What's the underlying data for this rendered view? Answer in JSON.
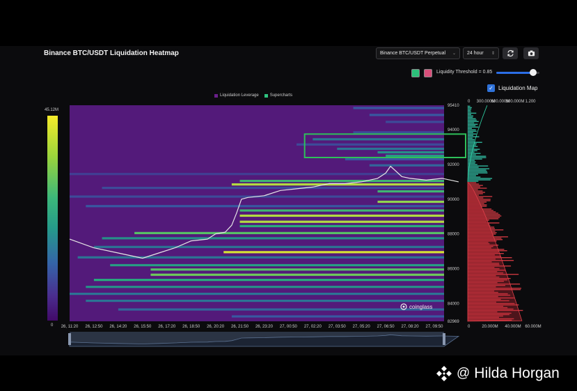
{
  "header": {
    "title": "Binance BTC/USDT Liquidation Heatmap",
    "pair_select": "Binance BTC/USDT Perpetual",
    "range_select": "24 hour",
    "refresh_icon": "refresh-icon",
    "camera_icon": "camera-icon"
  },
  "controls": {
    "threshold_label": "Liquidity Threshold = 0.85",
    "threshold_value": 0.85,
    "liquidation_map_label": "Liquidation Map",
    "liquidation_map_checked": true,
    "swatch_colors": [
      "#2cc07a",
      "#d94f7a"
    ]
  },
  "legend": {
    "items": [
      {
        "label": "Liquidation Leverage",
        "color": "#6a1f8a"
      },
      {
        "label": "Supercharts",
        "color": "#2ec27e"
      }
    ]
  },
  "colorbar": {
    "max_label": "45.12M",
    "min_label": "0"
  },
  "watermark": {
    "at": "@",
    "name": "Hilda Horgan",
    "icon": "diamond-logo-icon"
  },
  "brand": {
    "name": "coinglass",
    "icon": "coinglass-logo-icon"
  },
  "chart_data": {
    "type": "heatmap",
    "title": "Binance BTC/USDT Liquidation Heatmap",
    "x_tick_labels": [
      "26, 11:20",
      "26, 12:50",
      "26, 14:20",
      "26, 15:50",
      "26, 17:20",
      "26, 18:50",
      "26, 20:20",
      "26, 21:50",
      "26, 23:20",
      "27, 00:50",
      "27, 02:20",
      "27, 03:50",
      "27, 05:20",
      "27, 06:50",
      "27, 08:20",
      "27, 09:50"
    ],
    "y_tick_labels": [
      "95410",
      "94000",
      "92000",
      "90000",
      "88000",
      "86000",
      "84000",
      "82969"
    ],
    "ylim": [
      82969,
      95410
    ],
    "colorbar_range": [
      0,
      45.12
    ],
    "colorbar_unit": "M",
    "price_series": {
      "x_hours": [
        0,
        1.5,
        3,
        4.5,
        5.5,
        6.5,
        7.5,
        8.5,
        9,
        9.6,
        10,
        10.3,
        10.6,
        11,
        12,
        13,
        14,
        15,
        16,
        17,
        18,
        19,
        19.5,
        19.8,
        20.5,
        21,
        22,
        23,
        24
      ],
      "price": [
        87700,
        87200,
        86900,
        86600,
        86900,
        87200,
        87600,
        87700,
        88000,
        88100,
        88500,
        89200,
        90000,
        90100,
        90200,
        90500,
        90600,
        90700,
        90900,
        90900,
        91000,
        91200,
        91500,
        91900,
        91300,
        91200,
        91100,
        91200,
        91000
      ]
    },
    "liquidation_levels": [
      {
        "price": 95250,
        "start_hour": 17.5,
        "intensity": 0.35
      },
      {
        "price": 94850,
        "start_hour": 18.5,
        "intensity": 0.35
      },
      {
        "price": 94450,
        "start_hour": 19.5,
        "intensity": 0.3
      },
      {
        "price": 93850,
        "start_hour": 17.5,
        "intensity": 0.3
      },
      {
        "price": 93450,
        "start_hour": 15.0,
        "intensity": 0.45
      },
      {
        "price": 93150,
        "start_hour": 14.0,
        "intensity": 0.3
      },
      {
        "price": 92900,
        "start_hour": 16.5,
        "intensity": 0.45
      },
      {
        "price": 92700,
        "start_hour": 19.0,
        "intensity": 0.55
      },
      {
        "price": 92500,
        "start_hour": 19.5,
        "intensity": 0.6
      },
      {
        "price": 92300,
        "start_hour": 17.0,
        "intensity": 0.35
      },
      {
        "price": 91950,
        "start_hour": 18.5,
        "intensity": 0.4
      },
      {
        "price": 91450,
        "start_hour": 0.0,
        "intensity": 0.25
      },
      {
        "price": 91050,
        "start_hour": 10.5,
        "intensity": 0.7
      },
      {
        "price": 90850,
        "start_hour": 10.0,
        "intensity": 0.9
      },
      {
        "price": 90650,
        "start_hour": 2.0,
        "intensity": 0.3
      },
      {
        "price": 90450,
        "start_hour": 19.0,
        "intensity": 0.7
      },
      {
        "price": 90150,
        "start_hour": 0.0,
        "intensity": 0.3
      },
      {
        "price": 89850,
        "start_hour": 19.0,
        "intensity": 0.85
      },
      {
        "price": 89600,
        "start_hour": 1.0,
        "intensity": 0.35
      },
      {
        "price": 89350,
        "start_hour": 10.5,
        "intensity": 0.7
      },
      {
        "price": 89050,
        "start_hour": 10.5,
        "intensity": 0.9
      },
      {
        "price": 88700,
        "start_hour": 10.5,
        "intensity": 0.9
      },
      {
        "price": 88450,
        "start_hour": 10.5,
        "intensity": 0.65
      },
      {
        "price": 88050,
        "start_hour": 4.0,
        "intensity": 0.75
      },
      {
        "price": 87750,
        "start_hour": 2.0,
        "intensity": 0.55
      },
      {
        "price": 87250,
        "start_hour": 1.5,
        "intensity": 0.45
      },
      {
        "price": 86950,
        "start_hour": 9.5,
        "intensity": 0.95
      },
      {
        "price": 86650,
        "start_hour": 0.5,
        "intensity": 0.45
      },
      {
        "price": 86200,
        "start_hour": 2.5,
        "intensity": 0.6
      },
      {
        "price": 85950,
        "start_hour": 5.0,
        "intensity": 0.75
      },
      {
        "price": 85650,
        "start_hour": 5.0,
        "intensity": 0.8
      },
      {
        "price": 85350,
        "start_hour": 1.5,
        "intensity": 0.65
      },
      {
        "price": 84950,
        "start_hour": 1.0,
        "intensity": 0.55
      },
      {
        "price": 84550,
        "start_hour": 0.0,
        "intensity": 0.45
      },
      {
        "price": 84150,
        "start_hour": 1.0,
        "intensity": 0.45
      },
      {
        "price": 83650,
        "start_hour": 3.0,
        "intensity": 0.4
      },
      {
        "price": 83250,
        "start_hour": 10.0,
        "intensity": 0.35
      }
    ],
    "highlight_box": {
      "price_low": 92400,
      "price_high": 93750,
      "start_hour": 14.5
    },
    "liquidation_map": {
      "x_ticks_top": [
        "0",
        "300.000M",
        "600.000M",
        "900.000M",
        "1.200"
      ],
      "x_ticks_bottom": [
        "0",
        "20.000M",
        "40.000M",
        "60.000M"
      ]
    },
    "grid": false
  }
}
